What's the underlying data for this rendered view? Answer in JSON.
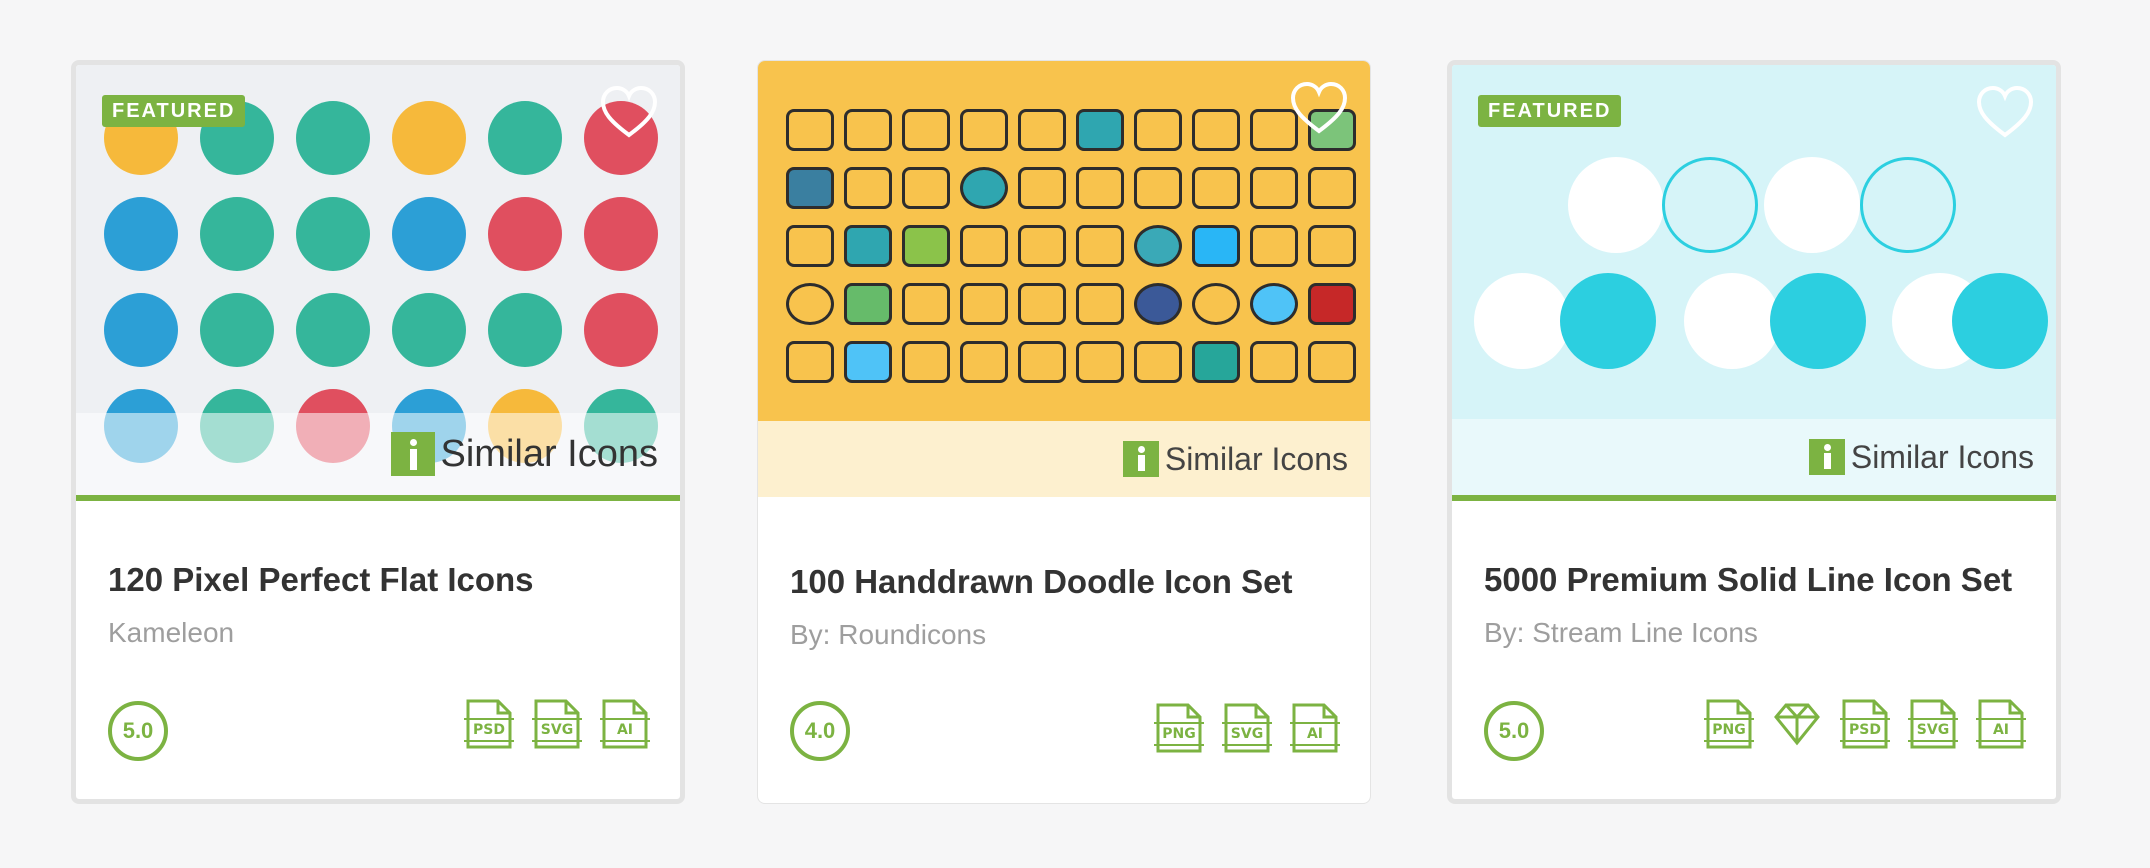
{
  "cards": [
    {
      "featured": "FEATURED",
      "similar": "Similar Icons",
      "title": "120 Pixel Perfect Flat Icons",
      "author": "Kameleon",
      "rating": "5.0",
      "formats": [
        "PSD",
        "SVG",
        "AI"
      ]
    },
    {
      "similar": "Similar Icons",
      "title": "100 Handdrawn Doodle Icon Set",
      "author": "By: Roundicons",
      "rating": "4.0",
      "formats": [
        "PNG",
        "SVG",
        "AI"
      ]
    },
    {
      "featured": "FEATURED",
      "similar": "Similar Icons",
      "title": "5000 Premium Solid Line Icon Set",
      "author": "By: Stream Line Icons",
      "rating": "5.0",
      "formats": [
        "PNG",
        "SKETCH",
        "PSD",
        "SVG",
        "AI"
      ]
    }
  ],
  "colors": {
    "accent": "#7cb342",
    "card1_bg": "#eef0f3",
    "card2_bg": "#f8c34d",
    "card3_bg": "#d6f4f8",
    "turquoise": "#2ccfe0"
  },
  "icons": {
    "heart": "heart-outline-icon",
    "similar": "similar-icons-logo",
    "rating": "rating-circle",
    "format": "file-format-icon",
    "sketch": "diamond-icon"
  }
}
